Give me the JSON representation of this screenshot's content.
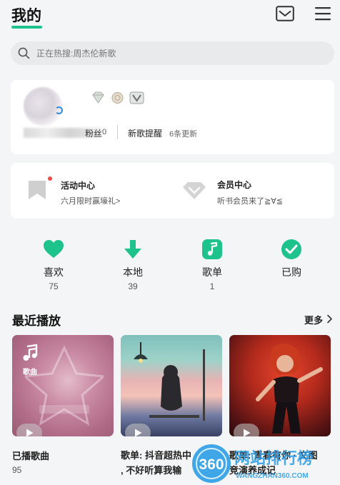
{
  "header": {
    "title": "我的",
    "mail_icon": "mail-icon",
    "menu_icon": "menu-icon",
    "accent": "#1ec28b"
  },
  "search": {
    "placeholder": "正在热搜:周杰伦新歌"
  },
  "profile": {
    "fans_label": "粉丝",
    "fans_count": "0",
    "new_songs_label": "新歌提醒",
    "new_songs_sub": "6条更新"
  },
  "activity": {
    "title": "活动中心",
    "subtitle": "六月限时赢壕礼>",
    "vip_title": "会员中心",
    "vip_subtitle": "听书会员来了≧∀≦"
  },
  "quick_links": [
    {
      "label": "喜欢",
      "count": "75",
      "icon": "heart-icon"
    },
    {
      "label": "本地",
      "count": "39",
      "icon": "download-icon"
    },
    {
      "label": "歌单",
      "count": "1",
      "icon": "music-note-icon"
    },
    {
      "label": "已购",
      "count": "",
      "icon": "check-icon"
    }
  ],
  "recent": {
    "title": "最近播放",
    "more": "更多",
    "tiles": [
      {
        "badge": "歌曲",
        "label": "已播歌曲",
        "count": "95"
      },
      {
        "label_line1": "歌单: 抖音超热中",
        "label_line2": ", 不好听算我输"
      },
      {
        "label_line1": "歌单: 青春有你 · 文图",
        "label_line2": "竞演养成记"
      }
    ]
  },
  "watermark": {
    "text": "360",
    "site": "WANGZHAN360.COM",
    "title_cn": "网站排行榜"
  },
  "colors": {
    "green": "#1ec28b",
    "red_dot": "#f04a4a"
  }
}
